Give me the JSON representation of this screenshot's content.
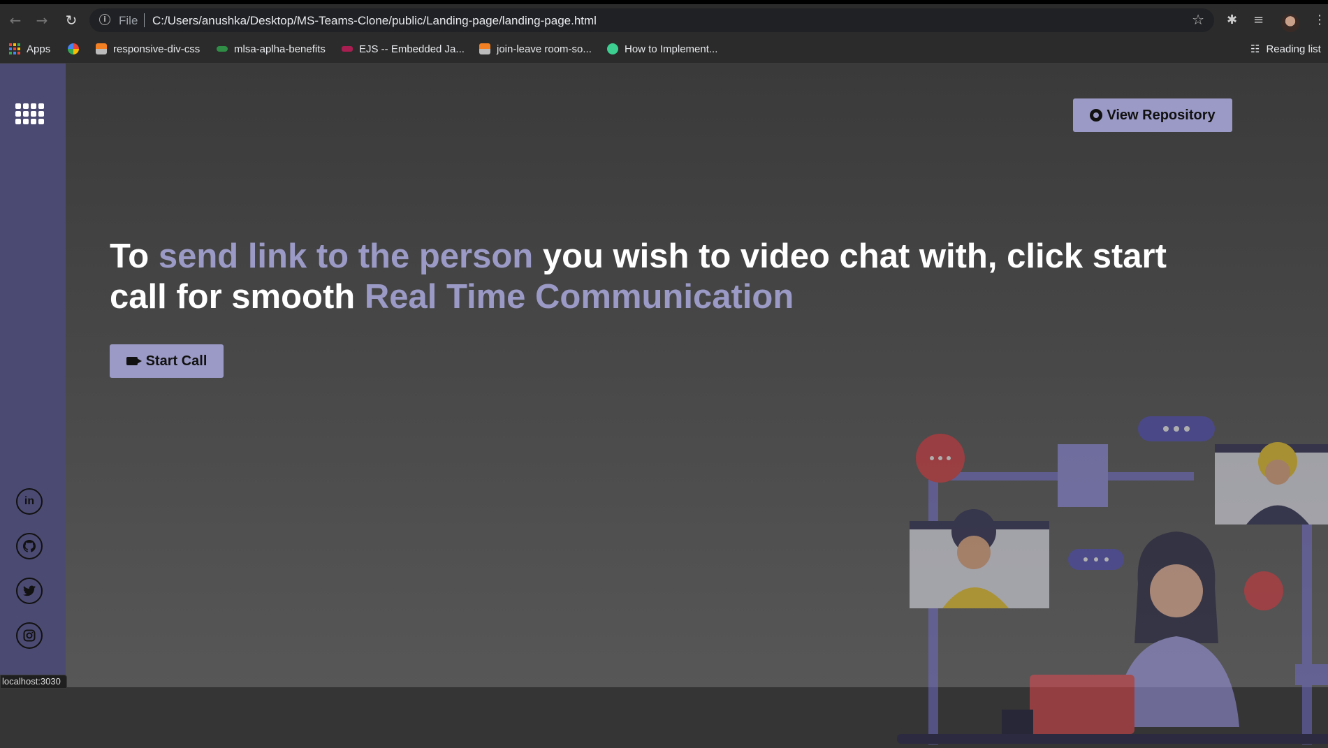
{
  "browser": {
    "omnibox": {
      "scheme_label": "File",
      "url": "C:/Users/anushka/Desktop/MS-Teams-Clone/public/Landing-page/landing-page.html"
    },
    "bookmarks": [
      {
        "label": "Apps",
        "icon": "apps-icon"
      },
      {
        "label": "",
        "icon": "google-photos-icon"
      },
      {
        "label": "responsive-div-css",
        "icon": "stackoverflow-icon"
      },
      {
        "label": "mlsa-aplha-benefits",
        "icon": "geeksforgeeks-icon"
      },
      {
        "label": "EJS -- Embedded Ja...",
        "icon": "ejs-icon"
      },
      {
        "label": "join-leave room-so...",
        "icon": "stackoverflow-icon"
      },
      {
        "label": "How to Implement...",
        "icon": "site-icon"
      }
    ],
    "reading_list": "Reading list",
    "status_url": "localhost:3030"
  },
  "page": {
    "repo_button": "View Repository",
    "headline": {
      "part1": "To ",
      "accent1": "send link to the person",
      "part2": " you wish to video chat with, click start call for smooth ",
      "accent2": "Real Time Communication"
    },
    "start_call_button": "Start Call",
    "social_links": [
      {
        "label": "in",
        "icon": "linkedin-icon"
      },
      {
        "label": "",
        "icon": "github-icon"
      },
      {
        "label": "",
        "icon": "twitter-icon"
      },
      {
        "label": "",
        "icon": "instagram-icon"
      }
    ],
    "colors": {
      "accent": "#9b9ac6",
      "sidebar": "#4b4a72",
      "background": "#353535"
    }
  }
}
